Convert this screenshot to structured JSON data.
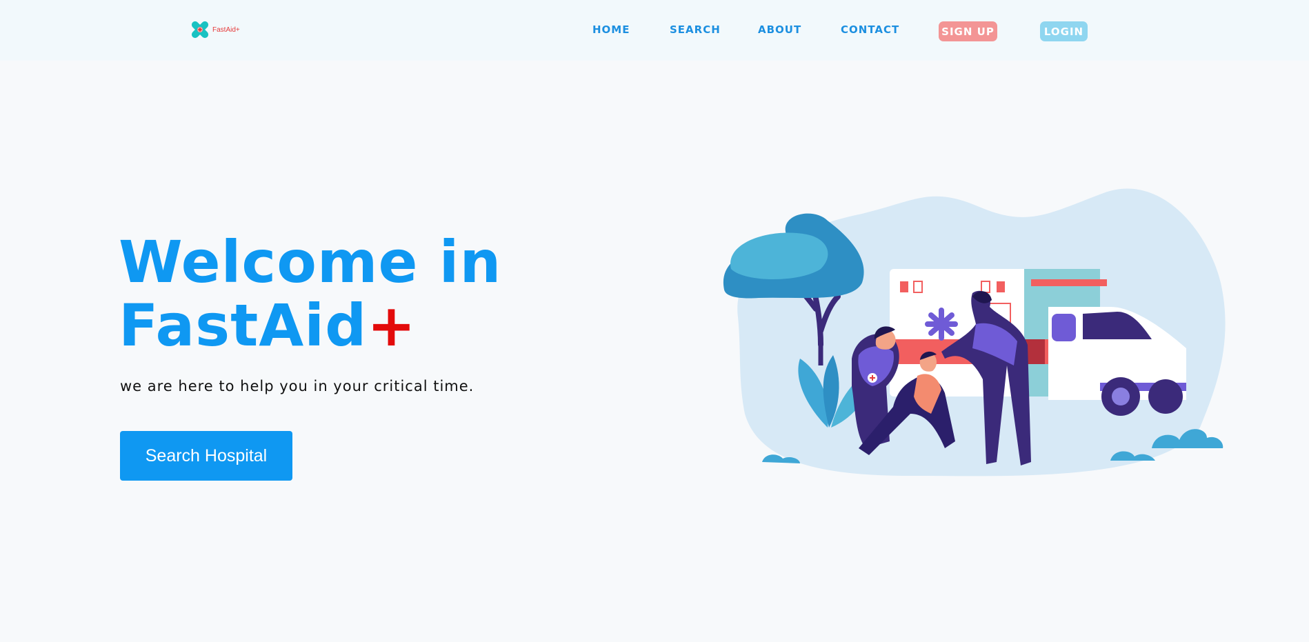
{
  "header": {
    "logo_text": "FastAid+",
    "nav": {
      "home": "HOME",
      "search": "SEARCH",
      "about": "ABOUT",
      "contact": "CONTACT"
    },
    "signup_label": "SIGN UP",
    "login_label": "LOGIN"
  },
  "hero": {
    "title_line1": "Welcome in",
    "title_line2": "FastAid",
    "title_plus": "+",
    "subtitle": "we are here to help you in your critical time.",
    "cta_label": "Search Hospital"
  },
  "colors": {
    "accent": "#0f98f2",
    "nav_text": "#1c8fe0",
    "signup_bg": "#f39595",
    "login_bg": "#8fd6f0",
    "plus_red": "#e30b0b"
  },
  "icons": {
    "logo": "bandage-cross-icon",
    "illustration": "ambulance-paramedics-illustration"
  }
}
